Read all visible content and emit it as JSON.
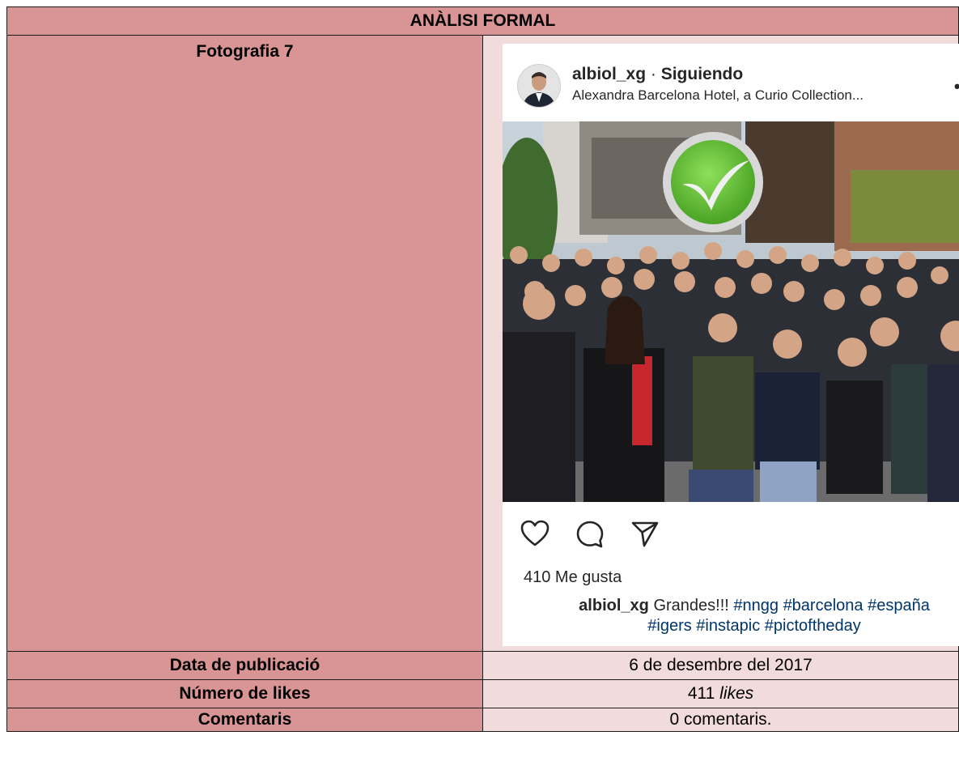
{
  "table": {
    "header": "ANÀLISI FORMAL",
    "photo_label": "Fotografia 7",
    "date_label": "Data de publicació",
    "date_value": "6 de desembre del 2017",
    "likes_label": "Número de likes",
    "likes_value_number": "411",
    "likes_value_unit": "likes",
    "comments_label": "Comentaris",
    "comments_value": "0 comentaris."
  },
  "post": {
    "username": "albiol_xg",
    "separator": "·",
    "follow_status": "Siguiendo",
    "location": "Alexandra Barcelona Hotel, a Curio Collection...",
    "more_icon": "more-horizontal-icon",
    "likes_text": "410 Me gusta",
    "caption_user": "albiol_xg",
    "caption_text": "Grandes!!!",
    "caption_tags_line1": "#nngg #barcelona #españa",
    "caption_tags_line2": "#igers #instapic #pictoftheday",
    "icons": [
      "heart-icon",
      "comment-icon",
      "share-icon",
      "bookmark-icon"
    ]
  },
  "colors": {
    "label_bg": "#d99594",
    "value_bg": "#f2dbdb",
    "hashtag": "#003569",
    "logo_green": "#6cc43a"
  }
}
